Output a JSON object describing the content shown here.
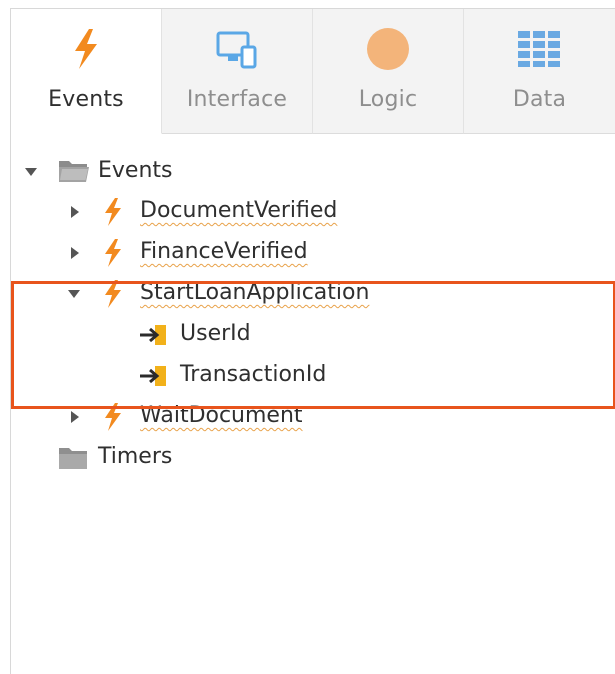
{
  "tabs": [
    {
      "label": "Events",
      "icon": "lightning-icon",
      "active": true
    },
    {
      "label": "Interface",
      "icon": "devices-icon",
      "active": false
    },
    {
      "label": "Logic",
      "icon": "logic-circle-icon",
      "active": false
    },
    {
      "label": "Data",
      "icon": "data-grid-icon",
      "active": false
    }
  ],
  "tree": {
    "root_folder": {
      "label": "Events",
      "expanded": true,
      "icon": "folder-open-icon"
    },
    "items": [
      {
        "label": "DocumentVerified",
        "icon": "lightning-icon",
        "expanded": false
      },
      {
        "label": "FinanceVerified",
        "icon": "lightning-icon",
        "expanded": false
      },
      {
        "label": "StartLoanApplication",
        "icon": "lightning-icon",
        "expanded": true,
        "params": [
          {
            "label": "UserId",
            "icon": "input-parameter-icon"
          },
          {
            "label": "TransactionId",
            "icon": "input-parameter-icon"
          }
        ]
      },
      {
        "label": "WaitDocument",
        "icon": "lightning-icon",
        "expanded": false
      }
    ],
    "timers_folder": {
      "label": "Timers",
      "icon": "folder-icon"
    }
  },
  "colors": {
    "accent_orange": "#f28a1f",
    "highlight_border": "#e8541c",
    "interface_blue": "#5aa7e6",
    "data_blue": "#6aa9e2",
    "logic_orange": "#f3b47a"
  }
}
